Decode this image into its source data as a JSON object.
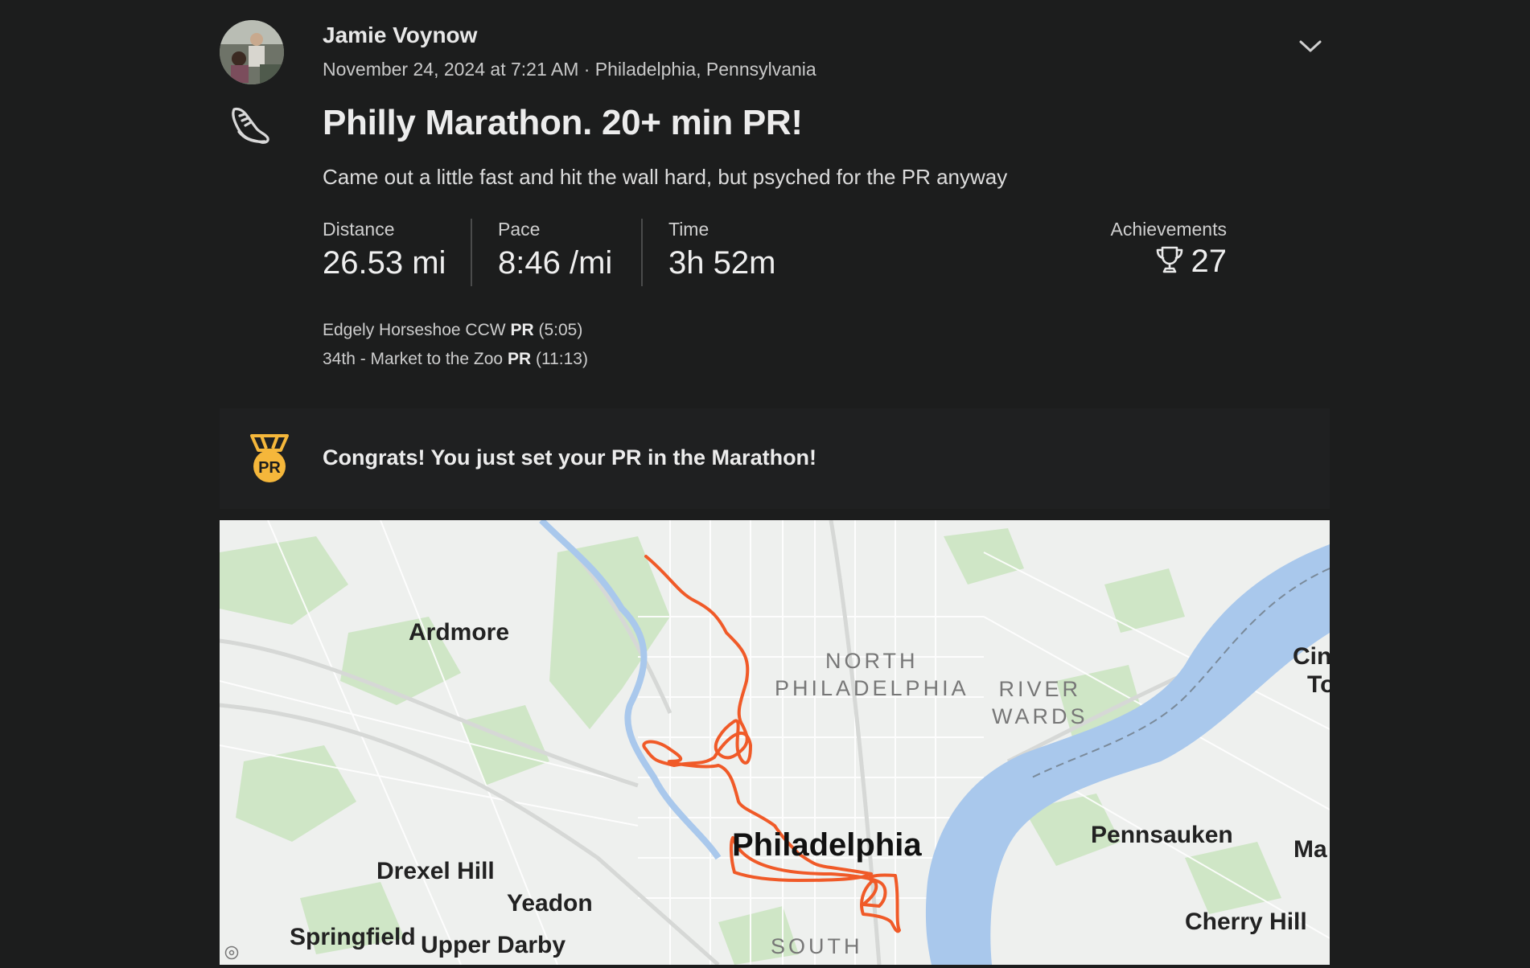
{
  "header": {
    "athlete_name": "Jamie Voynow",
    "activity_meta": "November 24, 2024 at 7:21 AM · Philadelphia, Pennsylvania",
    "avatar_icon": "avatar-photo",
    "options_icon": "chevron-down-icon",
    "sport_icon": "running-shoe-icon"
  },
  "activity": {
    "title": "Philly Marathon. 20+ min PR!",
    "description": "Came out a little fast and hit the wall hard, but psyched for the PR anyway"
  },
  "stats": [
    {
      "label": "Distance",
      "value": "26.53 mi"
    },
    {
      "label": "Pace",
      "value": "8:46 /mi"
    },
    {
      "label": "Time",
      "value": "3h 52m"
    }
  ],
  "achievements": {
    "label": "Achievements",
    "count": "27",
    "icon": "trophy-icon"
  },
  "segments": [
    {
      "name": "Edgely Horseshoe CCW",
      "badge": "PR",
      "time": "(5:05)"
    },
    {
      "name": "34th - Market to the Zoo",
      "badge": "PR",
      "time": "(11:13)"
    }
  ],
  "pr_banner": {
    "text": "Congrats! You just set your PR in the Marathon!",
    "icon": "pr-medal-icon",
    "medal_label": "PR",
    "medal_color": "#f5b73b"
  },
  "map": {
    "route_color": "#f05a28",
    "labels": {
      "ardmore": "Ardmore",
      "north_philadelphia_1": "NORTH",
      "north_philadelphia_2": "PHILADELPHIA",
      "river_wards_1": "RIVER",
      "river_wards_2": "WARDS",
      "cin": "Cin",
      "to": "To",
      "philadelphia": "Philadelphia",
      "pennsauken": "Pennsauken",
      "ma": "Ma",
      "drexel_hill": "Drexel Hill",
      "yeadon": "Yeadon",
      "springfield": "Springfield",
      "upper_darby": "Upper Darby",
      "south": "SOUTH",
      "cherry_hill": "Cherry Hill"
    }
  }
}
